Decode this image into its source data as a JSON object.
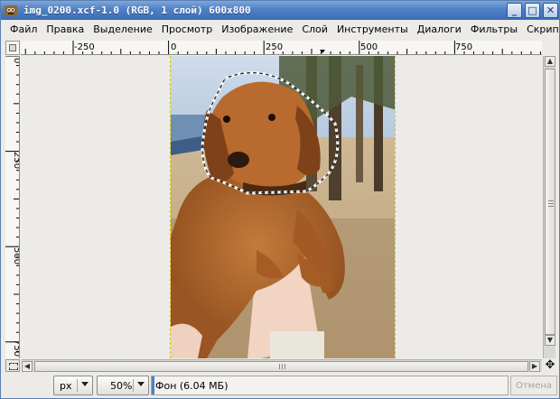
{
  "window": {
    "title": "img_0200.xcf-1.0 (RGB, 1 слой) 600x800",
    "minimize_label": "_",
    "maximize_label": "□",
    "close_label": "✕"
  },
  "menu": {
    "items": [
      "Файл",
      "Правка",
      "Выделение",
      "Просмотр",
      "Изображение",
      "Слой",
      "Инструменты",
      "Диалоги",
      "Фильтры",
      "Скрипт"
    ]
  },
  "rulers": {
    "horizontal_labels": [
      "-250",
      "0",
      "250",
      "500",
      "750"
    ],
    "vertical_labels": [
      "0",
      "250",
      "500",
      "750"
    ]
  },
  "statusbar": {
    "unit": "px",
    "zoom": "50%",
    "layer_info": "Фон (6.04 МБ)",
    "cancel_label": "Отмена"
  },
  "colors": {
    "titlebar": "#4f80c5",
    "image_border": "#d1c600"
  }
}
